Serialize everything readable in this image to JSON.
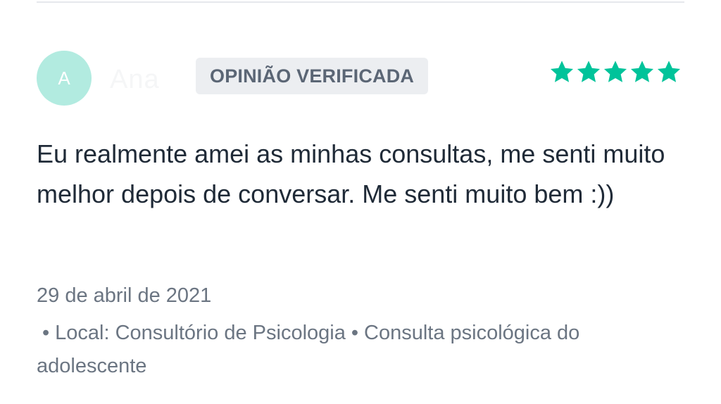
{
  "review": {
    "avatar_initial": "A",
    "author_name": "Ana",
    "badge_label": "OPINIÃO VERIFICADA",
    "rating": 5,
    "rating_max": 5,
    "star_color": "#00c39a",
    "text": "Eu realmente amei as minhas consultas, me senti muito melhor depois de conversar. Me senti muito bem :))",
    "date": "29 de abril de 2021",
    "bullet": "•",
    "location": "Local: Consultório de Psicologia",
    "service": "Consulta psicológica do adolescente"
  }
}
